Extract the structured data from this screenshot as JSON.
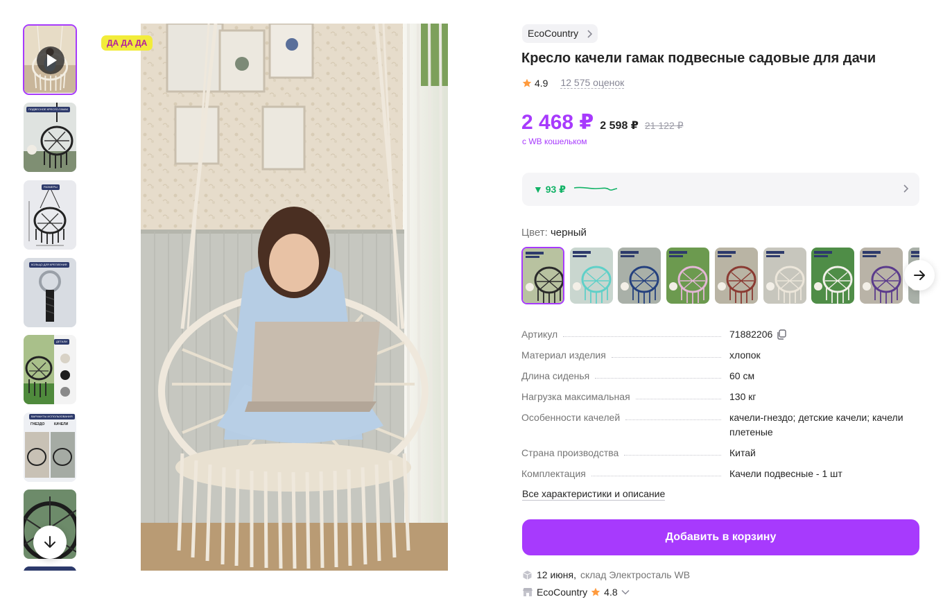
{
  "promo_badge": "ДА ДА ДА",
  "brand": {
    "name": "EcoCountry"
  },
  "product": {
    "title": "Кресло качели гамак подвесные садовые для дачи",
    "rating": "4.9",
    "reviews": "12 575 оценок"
  },
  "price": {
    "wallet_price": "2 468 ₽",
    "regular_price": "2 598 ₽",
    "old_price": "21 122 ₽",
    "wallet_note": "с WB кошельком"
  },
  "price_history": {
    "change": "▼ 93 ₽"
  },
  "color": {
    "label": "Цвет:",
    "value": "черный"
  },
  "colors": {
    "swatches": [
      {
        "name": "черный",
        "hoop": "#2a2a2a",
        "bg": "#b8c2a0"
      },
      {
        "name": "бирюзовый",
        "hoop": "#5fd0c8",
        "bg": "#c9d6cf"
      },
      {
        "name": "синий",
        "hoop": "#24407e",
        "bg": "#a9b0a8"
      },
      {
        "name": "розовый",
        "hoop": "#e4b7d6",
        "bg": "#6c9a4f"
      },
      {
        "name": "бордовый",
        "hoop": "#8a3a32",
        "bg": "#b9b4a4"
      },
      {
        "name": "белый",
        "hoop": "#ece6da",
        "bg": "#c7c6bd"
      },
      {
        "name": "белый",
        "hoop": "#f2f0ea",
        "bg": "#4f8d47"
      },
      {
        "name": "фиолетовый",
        "hoop": "#5a3a8c",
        "bg": "#b9b3a7"
      },
      {
        "name": "красный",
        "hoop": "#b03030",
        "bg": "#a9b0a8"
      }
    ]
  },
  "specs": [
    {
      "key": "Артикул",
      "value": "71882206",
      "copy": true
    },
    {
      "key": "Материал изделия",
      "value": "хлопок"
    },
    {
      "key": "Длина сиденья",
      "value": "60 см"
    },
    {
      "key": "Нагрузка максимальная",
      "value": "130 кг"
    },
    {
      "key": "Особенности качелей",
      "value": "качели-гнездо; детские качели; качели плетеные"
    },
    {
      "key": "Страна производства",
      "value": "Китай"
    },
    {
      "key": "Комплектация",
      "value": "Качели подвесные - 1 шт"
    }
  ],
  "all_specs_link": "Все характеристики и описание",
  "cart_button": "Добавить в корзину",
  "delivery": {
    "date": "12 июня,",
    "warehouse": "склад Электросталь WB"
  },
  "seller": {
    "name": "EcoCountry",
    "rating": "4.8"
  },
  "thumbnails": [
    {
      "tag": "",
      "video": true
    },
    {
      "tag": "ПОДВЕСНОЕ КРЕСЛО-ГАМАК",
      "video": false
    },
    {
      "tag": "РАЗМЕРЫ",
      "video": false
    },
    {
      "tag": "КОЛЬЦО ДЛЯ КРЕПЛЕНИЯ",
      "video": false
    },
    {
      "tag": "ДЕТАЛИ",
      "video": false
    },
    {
      "tag": "ВАРИАНТЫ ИСПОЛЬЗОВАНИЯ",
      "video": false
    },
    {
      "tag": "",
      "video": false
    }
  ],
  "theme": {
    "accent": "#a73afd",
    "green": "#10b265",
    "star": "#ff9b3e"
  }
}
